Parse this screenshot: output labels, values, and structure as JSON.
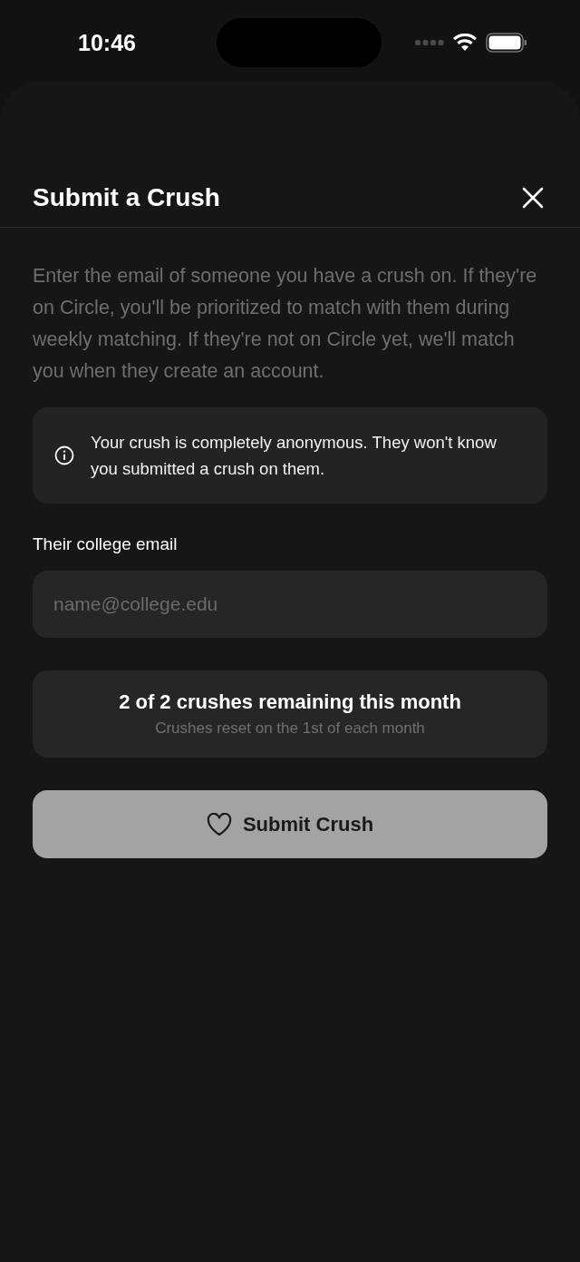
{
  "status_bar": {
    "time": "10:46"
  },
  "sheet": {
    "title": "Submit a Crush"
  },
  "description": "Enter the email of someone you have a crush on. If they're on Circle, you'll be prioritized to match with them during weekly matching. If they're not on Circle yet, we'll match you when they create an account.",
  "notice": "Your crush is completely anonymous. They won't know you submitted a crush on them.",
  "email_field": {
    "label": "Their college email",
    "placeholder": "name@college.edu"
  },
  "quota": {
    "title": "2 of 2 crushes remaining this month",
    "subtitle": "Crushes reset on the 1st of each month"
  },
  "submit_button": {
    "label": "Submit Crush",
    "disabled": true
  }
}
